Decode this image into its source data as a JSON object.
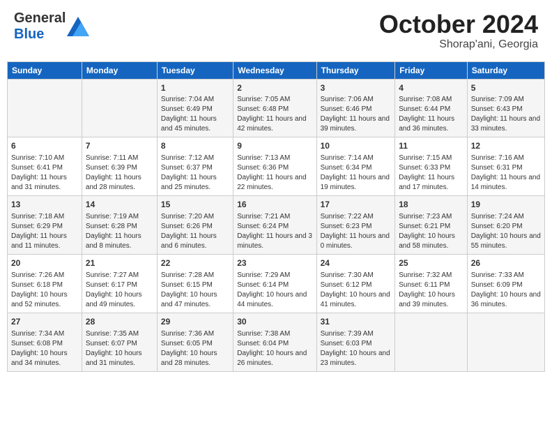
{
  "header": {
    "logo_general": "General",
    "logo_blue": "Blue",
    "month": "October 2024",
    "location": "Shorap'ani, Georgia"
  },
  "weekdays": [
    "Sunday",
    "Monday",
    "Tuesday",
    "Wednesday",
    "Thursday",
    "Friday",
    "Saturday"
  ],
  "weeks": [
    [
      {
        "day": "",
        "info": ""
      },
      {
        "day": "",
        "info": ""
      },
      {
        "day": "1",
        "info": "Sunrise: 7:04 AM\nSunset: 6:49 PM\nDaylight: 11 hours and 45 minutes."
      },
      {
        "day": "2",
        "info": "Sunrise: 7:05 AM\nSunset: 6:48 PM\nDaylight: 11 hours and 42 minutes."
      },
      {
        "day": "3",
        "info": "Sunrise: 7:06 AM\nSunset: 6:46 PM\nDaylight: 11 hours and 39 minutes."
      },
      {
        "day": "4",
        "info": "Sunrise: 7:08 AM\nSunset: 6:44 PM\nDaylight: 11 hours and 36 minutes."
      },
      {
        "day": "5",
        "info": "Sunrise: 7:09 AM\nSunset: 6:43 PM\nDaylight: 11 hours and 33 minutes."
      }
    ],
    [
      {
        "day": "6",
        "info": "Sunrise: 7:10 AM\nSunset: 6:41 PM\nDaylight: 11 hours and 31 minutes."
      },
      {
        "day": "7",
        "info": "Sunrise: 7:11 AM\nSunset: 6:39 PM\nDaylight: 11 hours and 28 minutes."
      },
      {
        "day": "8",
        "info": "Sunrise: 7:12 AM\nSunset: 6:37 PM\nDaylight: 11 hours and 25 minutes."
      },
      {
        "day": "9",
        "info": "Sunrise: 7:13 AM\nSunset: 6:36 PM\nDaylight: 11 hours and 22 minutes."
      },
      {
        "day": "10",
        "info": "Sunrise: 7:14 AM\nSunset: 6:34 PM\nDaylight: 11 hours and 19 minutes."
      },
      {
        "day": "11",
        "info": "Sunrise: 7:15 AM\nSunset: 6:33 PM\nDaylight: 11 hours and 17 minutes."
      },
      {
        "day": "12",
        "info": "Sunrise: 7:16 AM\nSunset: 6:31 PM\nDaylight: 11 hours and 14 minutes."
      }
    ],
    [
      {
        "day": "13",
        "info": "Sunrise: 7:18 AM\nSunset: 6:29 PM\nDaylight: 11 hours and 11 minutes."
      },
      {
        "day": "14",
        "info": "Sunrise: 7:19 AM\nSunset: 6:28 PM\nDaylight: 11 hours and 8 minutes."
      },
      {
        "day": "15",
        "info": "Sunrise: 7:20 AM\nSunset: 6:26 PM\nDaylight: 11 hours and 6 minutes."
      },
      {
        "day": "16",
        "info": "Sunrise: 7:21 AM\nSunset: 6:24 PM\nDaylight: 11 hours and 3 minutes."
      },
      {
        "day": "17",
        "info": "Sunrise: 7:22 AM\nSunset: 6:23 PM\nDaylight: 11 hours and 0 minutes."
      },
      {
        "day": "18",
        "info": "Sunrise: 7:23 AM\nSunset: 6:21 PM\nDaylight: 10 hours and 58 minutes."
      },
      {
        "day": "19",
        "info": "Sunrise: 7:24 AM\nSunset: 6:20 PM\nDaylight: 10 hours and 55 minutes."
      }
    ],
    [
      {
        "day": "20",
        "info": "Sunrise: 7:26 AM\nSunset: 6:18 PM\nDaylight: 10 hours and 52 minutes."
      },
      {
        "day": "21",
        "info": "Sunrise: 7:27 AM\nSunset: 6:17 PM\nDaylight: 10 hours and 49 minutes."
      },
      {
        "day": "22",
        "info": "Sunrise: 7:28 AM\nSunset: 6:15 PM\nDaylight: 10 hours and 47 minutes."
      },
      {
        "day": "23",
        "info": "Sunrise: 7:29 AM\nSunset: 6:14 PM\nDaylight: 10 hours and 44 minutes."
      },
      {
        "day": "24",
        "info": "Sunrise: 7:30 AM\nSunset: 6:12 PM\nDaylight: 10 hours and 41 minutes."
      },
      {
        "day": "25",
        "info": "Sunrise: 7:32 AM\nSunset: 6:11 PM\nDaylight: 10 hours and 39 minutes."
      },
      {
        "day": "26",
        "info": "Sunrise: 7:33 AM\nSunset: 6:09 PM\nDaylight: 10 hours and 36 minutes."
      }
    ],
    [
      {
        "day": "27",
        "info": "Sunrise: 7:34 AM\nSunset: 6:08 PM\nDaylight: 10 hours and 34 minutes."
      },
      {
        "day": "28",
        "info": "Sunrise: 7:35 AM\nSunset: 6:07 PM\nDaylight: 10 hours and 31 minutes."
      },
      {
        "day": "29",
        "info": "Sunrise: 7:36 AM\nSunset: 6:05 PM\nDaylight: 10 hours and 28 minutes."
      },
      {
        "day": "30",
        "info": "Sunrise: 7:38 AM\nSunset: 6:04 PM\nDaylight: 10 hours and 26 minutes."
      },
      {
        "day": "31",
        "info": "Sunrise: 7:39 AM\nSunset: 6:03 PM\nDaylight: 10 hours and 23 minutes."
      },
      {
        "day": "",
        "info": ""
      },
      {
        "day": "",
        "info": ""
      }
    ]
  ]
}
